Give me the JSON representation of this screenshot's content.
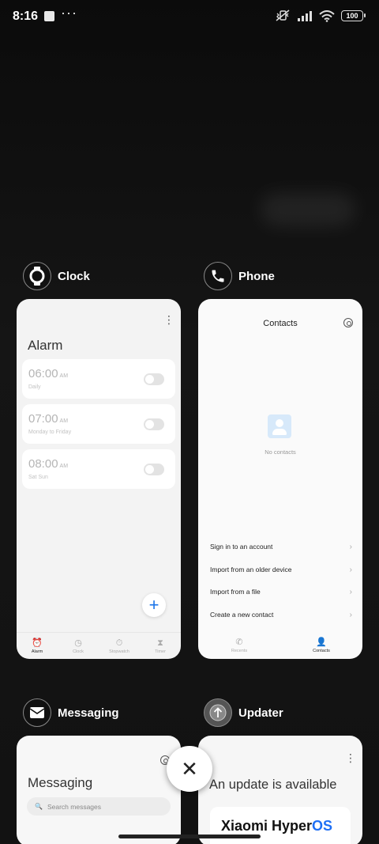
{
  "status_bar": {
    "time": "8:16",
    "overflow": "···",
    "battery": "100",
    "icons": [
      "notification-square-icon",
      "vibrate-icon",
      "signal-icon",
      "wifi-icon",
      "battery-icon"
    ]
  },
  "apps": {
    "clock": {
      "name": "Clock",
      "title": "Alarm",
      "alarms": [
        {
          "time": "06:00",
          "ampm": "AM",
          "repeat": "Daily"
        },
        {
          "time": "07:00",
          "ampm": "AM",
          "repeat": "Monday to Friday"
        },
        {
          "time": "08:00",
          "ampm": "AM",
          "repeat": "Sat Sun"
        }
      ],
      "nav": [
        {
          "label": "Alarm",
          "icon": "⏰"
        },
        {
          "label": "Clock",
          "icon": "◷"
        },
        {
          "label": "Stopwatch",
          "icon": "⏱"
        },
        {
          "label": "Timer",
          "icon": "⧗"
        }
      ],
      "add_symbol": "+"
    },
    "phone": {
      "name": "Phone",
      "title": "Contacts",
      "empty_text": "No contacts",
      "actions": [
        "Sign in to an account",
        "Import from an older device",
        "Import from a file",
        "Create a new contact"
      ],
      "nav": [
        {
          "label": "Recents",
          "icon": "✆"
        },
        {
          "label": "Contacts",
          "icon": "👤"
        }
      ]
    },
    "messaging": {
      "name": "Messaging",
      "title": "Messaging",
      "search_placeholder": "Search messages"
    },
    "updater": {
      "name": "Updater",
      "title": "An update is available",
      "brand": "Xiaomi Hyper",
      "brand_os": "OS"
    }
  },
  "close_symbol": "✕"
}
